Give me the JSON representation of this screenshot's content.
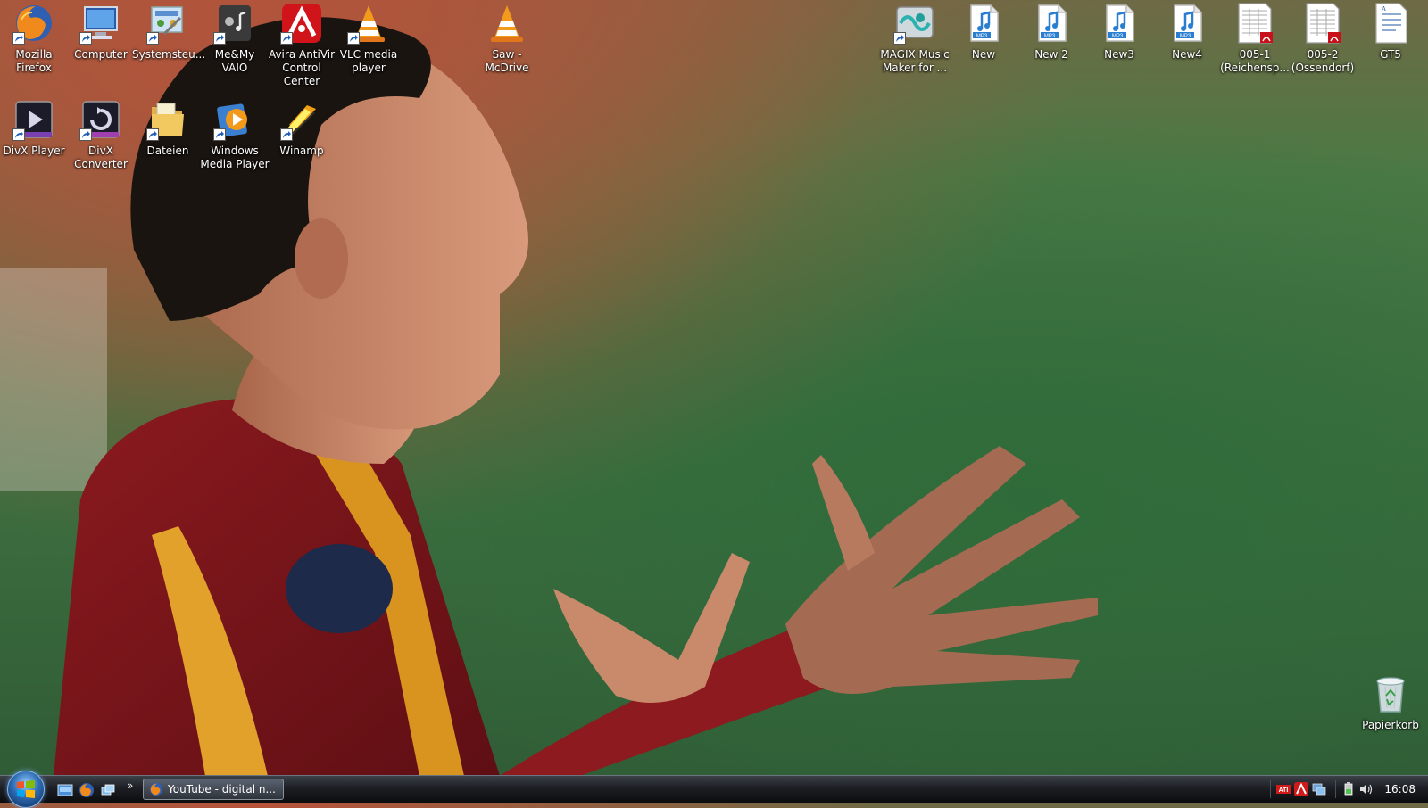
{
  "desktop": {
    "icons": [
      {
        "label": "Mozilla\nFirefox",
        "icon": "firefox-icon"
      },
      {
        "label": "Computer",
        "icon": "computer-icon"
      },
      {
        "label": "Systemsteu...",
        "icon": "control-panel-icon"
      },
      {
        "label": "Me&My\nVAIO",
        "icon": "vaio-icon"
      },
      {
        "label": "Avira AntiVir\nControl\nCenter",
        "icon": "avira-icon"
      },
      {
        "label": "VLC media\nplayer",
        "icon": "vlc-icon"
      },
      {
        "label": "Saw -\nMcDrive",
        "icon": "vlc-file-icon"
      },
      {
        "label": "DivX Player",
        "icon": "divx-player-icon"
      },
      {
        "label": "DivX\nConverter",
        "icon": "divx-converter-icon"
      },
      {
        "label": "Dateien",
        "icon": "folder-icon"
      },
      {
        "label": "Windows\nMedia Player",
        "icon": "wmp-icon"
      },
      {
        "label": "Winamp",
        "icon": "winamp-icon"
      },
      {
        "label": "MAGIX Music\nMaker for ...",
        "icon": "magix-icon"
      },
      {
        "label": "New",
        "icon": "mp3-icon"
      },
      {
        "label": "New 2",
        "icon": "mp3-icon"
      },
      {
        "label": "New3",
        "icon": "mp3-icon"
      },
      {
        "label": "New4",
        "icon": "mp3-icon"
      },
      {
        "label": "005-1\n(Reichensp...",
        "icon": "pdf-icon"
      },
      {
        "label": "005-2\n(Ossendorf)",
        "icon": "pdf-icon"
      },
      {
        "label": "GT5",
        "icon": "document-icon"
      },
      {
        "label": "Papierkorb",
        "icon": "recycle-bin-icon"
      }
    ]
  },
  "taskbar": {
    "quick_launch_more": "»",
    "tasks": [
      {
        "label": "YouTube - digital n...",
        "icon": "firefox-icon"
      }
    ],
    "tray": {
      "icons": [
        "ati-icon",
        "avira-tray-icon",
        "network-icon",
        "power-icon",
        "volume-icon"
      ],
      "clock": "16:08"
    }
  },
  "colors": {
    "taskbar_top": "#3c4148",
    "taskbar_bottom": "#0b0c0e",
    "icon_label": "#ffffff"
  }
}
